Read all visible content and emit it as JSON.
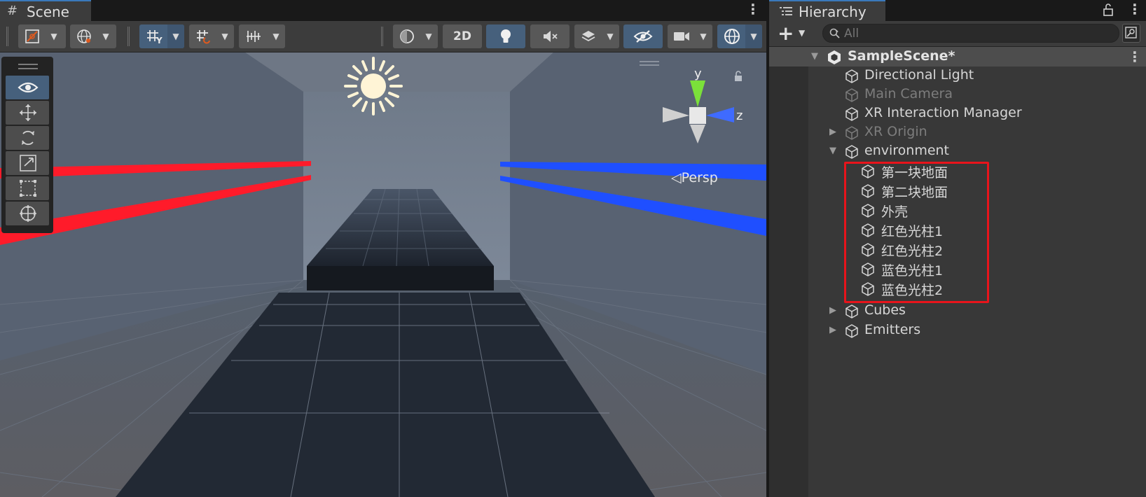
{
  "scene_panel": {
    "tab_label": "Scene",
    "tab_icon": "hash-grid-icon",
    "toolbar": {
      "button_2d_label": "2D",
      "buttons": [
        "draw-mode-icon",
        "global-local-icon",
        "grid-snap-icon",
        "snap-increment-icon",
        "ruler-icon",
        "render-mode-icon",
        "2d-toggle",
        "lighting-icon",
        "audio-mute-icon",
        "effects-icon",
        "hidden-objects-icon",
        "camera-icon",
        "gizmos-icon"
      ]
    },
    "viewport": {
      "persp_label": "◁Persp",
      "gizmo_y_label": "y",
      "gizmo_z_label": "z",
      "tools": [
        "view-tool-icon",
        "move-tool-icon",
        "rotate-tool-icon",
        "scale-tool-icon",
        "rect-tool-icon",
        "transform-tool-icon"
      ]
    },
    "colors": {
      "red_bar": "#ff1b2a",
      "blue_bar": "#1f4fff",
      "active_blue": "#46607c"
    }
  },
  "hierarchy_panel": {
    "tab_label": "Hierarchy",
    "search_placeholder": "All",
    "scene_name": "SampleScene*",
    "items": [
      {
        "label": "Directional Light",
        "depth": 1,
        "expanded": null,
        "dimmed": false
      },
      {
        "label": "Main Camera",
        "depth": 1,
        "expanded": null,
        "dimmed": true
      },
      {
        "label": "XR Interaction Manager",
        "depth": 1,
        "expanded": null,
        "dimmed": false
      },
      {
        "label": "XR Origin",
        "depth": 1,
        "expanded": false,
        "dimmed": true
      },
      {
        "label": "environment",
        "depth": 1,
        "expanded": true,
        "dimmed": false
      },
      {
        "label": "第一块地面",
        "depth": 2,
        "expanded": null,
        "dimmed": false
      },
      {
        "label": "第二块地面",
        "depth": 2,
        "expanded": null,
        "dimmed": false
      },
      {
        "label": "外壳",
        "depth": 2,
        "expanded": null,
        "dimmed": false
      },
      {
        "label": "红色光柱1",
        "depth": 2,
        "expanded": null,
        "dimmed": false
      },
      {
        "label": "红色光柱2",
        "depth": 2,
        "expanded": null,
        "dimmed": false
      },
      {
        "label": "蓝色光柱1",
        "depth": 2,
        "expanded": null,
        "dimmed": false
      },
      {
        "label": "蓝色光柱2",
        "depth": 2,
        "expanded": null,
        "dimmed": false
      },
      {
        "label": "Cubes",
        "depth": 1,
        "expanded": false,
        "dimmed": false
      },
      {
        "label": "Emitters",
        "depth": 1,
        "expanded": false,
        "dimmed": false
      }
    ],
    "highlight_color": "#e8141b"
  }
}
